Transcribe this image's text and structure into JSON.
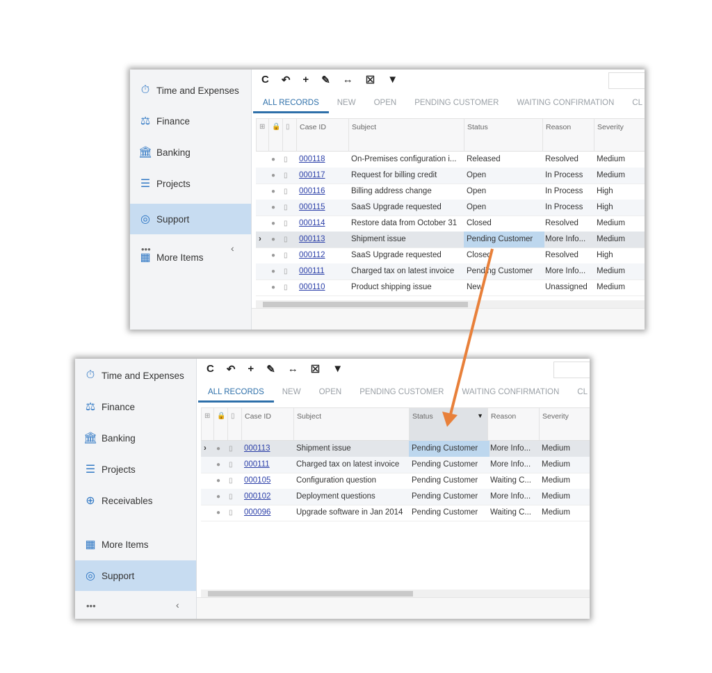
{
  "sidebar": {
    "items": [
      {
        "label": "Time and Expenses",
        "icon": "stopwatch-icon"
      },
      {
        "label": "Finance",
        "icon": "scales-icon"
      },
      {
        "label": "Banking",
        "icon": "bank-icon"
      },
      {
        "label": "Projects",
        "icon": "projects-icon"
      },
      {
        "label": "Receivables",
        "icon": "plus-circle-icon"
      },
      {
        "label": "More Items",
        "icon": "grid-icon"
      },
      {
        "label": "Support",
        "icon": "lifebuoy-icon",
        "selected": true
      }
    ],
    "more": "•••",
    "collapse": "‹"
  },
  "toolbar": [
    {
      "icon": "refresh-icon",
      "glyph": "C"
    },
    {
      "icon": "undo-icon",
      "glyph": "↶"
    },
    {
      "icon": "add-icon",
      "glyph": "+"
    },
    {
      "icon": "edit-icon",
      "glyph": "✎"
    },
    {
      "icon": "fit-columns-icon",
      "glyph": "↔"
    },
    {
      "icon": "export-excel-icon",
      "glyph": "☒"
    },
    {
      "icon": "filter-icon",
      "glyph": "▼"
    }
  ],
  "tabs": [
    "ALL RECORDS",
    "NEW",
    "OPEN",
    "PENDING CUSTOMER",
    "WAITING CONFIRMATION",
    "CL"
  ],
  "columns": [
    "Case ID",
    "Subject",
    "Status",
    "Reason",
    "Severity"
  ],
  "accent": "#2d6fa9",
  "arrow_color": "#e8803a",
  "before": {
    "rows": [
      [
        "000118",
        "On-Premises configuration i...",
        "Released",
        "Resolved",
        "Medium"
      ],
      [
        "000117",
        "Request for billing credit",
        "Open",
        "In Process",
        "Medium"
      ],
      [
        "000116",
        "Billing address change",
        "Open",
        "In Process",
        "High"
      ],
      [
        "000115",
        "SaaS Upgrade requested",
        "Open",
        "In Process",
        "High"
      ],
      [
        "000114",
        "Restore data from October 31",
        "Closed",
        "Resolved",
        "Medium"
      ],
      [
        "000113",
        "Shipment issue",
        "Pending Customer",
        "More Info...",
        "Medium"
      ],
      [
        "000112",
        "SaaS Upgrade requested",
        "Closed",
        "Resolved",
        "High"
      ],
      [
        "000111",
        "Charged tax on latest invoice",
        "Pending Customer",
        "More Info...",
        "Medium"
      ],
      [
        "000110",
        "Product shipping issue",
        "New",
        "Unassigned",
        "Medium"
      ]
    ],
    "current": 5
  },
  "after": {
    "rows": [
      [
        "000113",
        "Shipment issue",
        "Pending Customer",
        "More Info...",
        "Medium"
      ],
      [
        "000111",
        "Charged tax on latest invoice",
        "Pending Customer",
        "More Info...",
        "Medium"
      ],
      [
        "000105",
        "Configuration question",
        "Pending Customer",
        "Waiting C...",
        "Medium"
      ],
      [
        "000102",
        "Deployment questions",
        "Pending Customer",
        "More Info...",
        "Medium"
      ],
      [
        "000096",
        "Upgrade software in Jan 2014",
        "Pending Customer",
        "Waiting C...",
        "Medium"
      ]
    ],
    "current": 0,
    "filtered_column": "Status"
  }
}
